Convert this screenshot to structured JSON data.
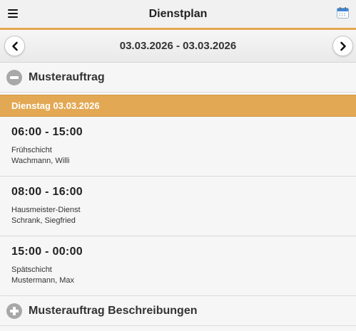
{
  "header": {
    "title": "Dienstplan",
    "menu_icon": "hamburger-menu-icon",
    "calendar_icon": "calendar-icon"
  },
  "date_nav": {
    "range": "03.03.2026 - 03.03.2026",
    "prev_icon": "chevron-left-icon",
    "next_icon": "chevron-right-icon"
  },
  "sections": [
    {
      "title": "Musterauftrag",
      "state": "expanded",
      "day_header": "Dienstag 03.03.2026",
      "shifts": [
        {
          "time": "06:00 - 15:00",
          "type": "Frühschicht",
          "person": "Wachmann, Willi"
        },
        {
          "time": "08:00 - 16:00",
          "type": "Hausmeister-Dienst",
          "person": "Schrank, Siegfried"
        },
        {
          "time": "15:00 - 00:00",
          "type": "Spätschicht",
          "person": "Mustermann, Max"
        }
      ]
    },
    {
      "title": "Musterauftrag Beschreibungen",
      "state": "collapsed"
    }
  ],
  "colors": {
    "accent": "#e3a853",
    "header_bg": "#f1f1f1",
    "page_bg": "#f6f6f6",
    "collapse_icon": "#a8a8a8"
  }
}
